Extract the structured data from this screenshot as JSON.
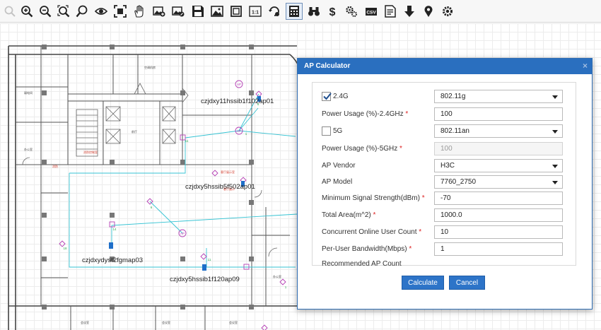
{
  "toolbar": {
    "icons": [
      "select-icon",
      "zoom-in-icon",
      "zoom-out-icon",
      "zoom-fit-icon",
      "search-icon",
      "eye-icon",
      "fullscreen-icon",
      "pan-hand-icon",
      "add-image-icon",
      "edit-image-icon",
      "save-icon",
      "image-icon",
      "frame-icon",
      "actual-size-icon",
      "refresh-location-icon",
      "calculator-icon",
      "binoculars-icon",
      "dollar-icon",
      "settings-icon",
      "csv-export-icon",
      "report-icon",
      "download-icon",
      "location-pin-icon",
      "gear-icon"
    ],
    "actual_size_label": "1:1",
    "csv_label": "CSV",
    "active_icon": "calculator-icon"
  },
  "map": {
    "ap_labels": [
      "czjdxy11hssib1f102ap01",
      "czjdxy5hssib5f502ap01",
      "czjdxydyst2fgmap03",
      "czjdxy5hssib1f120ap09"
    ]
  },
  "dialog": {
    "title": "AP Calculator",
    "close_label": "×",
    "band_24": {
      "label": "2.4G",
      "checked": true,
      "standard": "802.11g"
    },
    "power_24": {
      "label": "Power Usage (%)-2.4GHz",
      "required": "*",
      "value": "100"
    },
    "band_5": {
      "label": "5G",
      "checked": false,
      "standard": "802.11an"
    },
    "power_5": {
      "label": "Power Usage (%)-5GHz",
      "required": "*",
      "placeholder": "100"
    },
    "vendor": {
      "label": "AP Vendor",
      "value": "H3C"
    },
    "model": {
      "label": "AP Model",
      "value": "7760_2750"
    },
    "min_signal": {
      "label": "Minimum Signal Strength(dBm)",
      "required": "*",
      "value": "-70"
    },
    "area": {
      "label": "Total Area(m^2)",
      "required": "*",
      "value": "1000.0"
    },
    "users": {
      "label": "Concurrent Online User Count",
      "required": "*",
      "value": "10"
    },
    "bandwidth": {
      "label": "Per-User Bandwidth(Mbps)",
      "required": "*",
      "value": "1"
    },
    "recommended": {
      "label": "Recommended AP Count"
    },
    "calculate_label": "Calculate",
    "cancel_label": "Cancel"
  }
}
